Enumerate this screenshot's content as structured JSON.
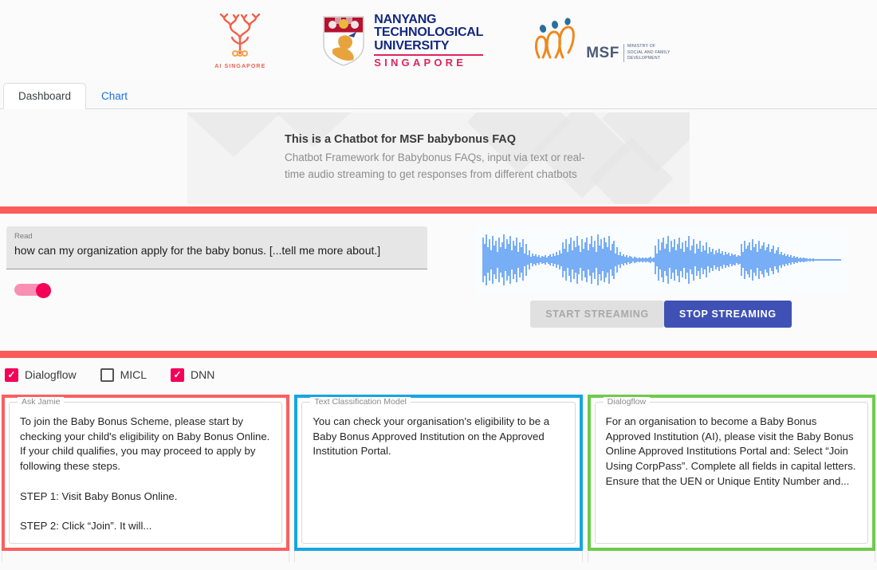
{
  "logos": {
    "aisg": {
      "name": "ai-singapore-logo",
      "wordmark": "AI SINGAPORE"
    },
    "ntu": {
      "name": "ntu-logo",
      "line1": "NANYANG",
      "line2": "TECHNOLOGICAL",
      "line3": "UNIVERSITY",
      "country": "SINGAPORE"
    },
    "msf": {
      "name": "msf-logo",
      "acronym": "MSF",
      "sub_line1": "MINISTRY OF",
      "sub_line2": "SOCIAL AND FAMILY",
      "sub_line3": "DEVELOPMENT"
    }
  },
  "tabs": [
    {
      "label": "Dashboard",
      "active": true
    },
    {
      "label": "Chart",
      "active": false
    }
  ],
  "hero": {
    "title": "This is a Chatbot for MSF babybonus FAQ",
    "subtitle": "Chatbot Framework for Babybonus FAQs, input via text or real-time audio streaming to get responses from different chatbots"
  },
  "input": {
    "label": "Read",
    "value": "how can my organization apply for the baby bonus. [...tell me more about.]",
    "placeholder": "Read",
    "toggle_on": true
  },
  "streaming": {
    "start_label": "START STREAMING",
    "stop_label": "STOP STREAMING",
    "start_disabled": true,
    "stop_active": true,
    "waveform_color": "#2b7fef"
  },
  "model_checkboxes": [
    {
      "label": "Dialogflow",
      "checked": true
    },
    {
      "label": "MICL",
      "checked": false
    },
    {
      "label": "DNN",
      "checked": true
    }
  ],
  "results": [
    {
      "legend": "Ask Jamie",
      "border_color": "#fa6060",
      "text": "To join the Baby Bonus Scheme, please start by checking your child's eligibility on Baby Bonus Online. If your child qualifies, you may proceed to apply by following these steps.\n\nSTEP 1: Visit Baby Bonus Online.\n\nSTEP 2: Click “Join”. It will..."
    },
    {
      "legend": "Text Classification Model",
      "border_color": "#16a6e0",
      "text": "You can check your organisation's eligibility to be a Baby Bonus Approved Institution on the Approved Institution Portal."
    },
    {
      "legend": "Dialogflow",
      "border_color": "#6ecb4b",
      "text": "For an organisation to become a Baby Bonus Approved Institution (AI), please visit the Baby Bonus Online Approved Institutions Portal and: Select “Join Using CorpPass”. Complete all fields in capital letters. Ensure that the UEN or Unique Entity Number and..."
    }
  ],
  "colors": {
    "divider_red": "#fb5b5b",
    "accent_pink": "#f50057",
    "primary_indigo": "#3f51b5",
    "link_blue": "#1a73e8"
  },
  "check_glyph": "✓"
}
